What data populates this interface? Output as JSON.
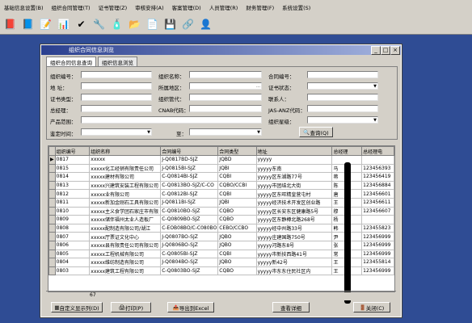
{
  "menu": [
    "基础信息设置(B)",
    "组织合同管理(T)",
    "证书管理(Z)",
    "审核安排(A)",
    "客案管理(D)",
    "人员管理(R)",
    "财务管理(F)",
    "系统设置(S)"
  ],
  "window": {
    "title": "组织合同信息浏览"
  },
  "tabs": [
    "组织合同信息查询",
    "组织信息浏览"
  ],
  "form": {
    "org_no": "组织编号：",
    "org_name": "组织名称：",
    "contract_no": "合同编号：",
    "address": "地  址：",
    "region": "所属地区：",
    "cert_status": "证书状态：",
    "cert_type": "证书类型：",
    "org_manager": "组织管代：",
    "contact": "联系人：",
    "general_manager": "总经理：",
    "cnab_code": "CNAB代码：",
    "jas_code": "JAS-ANZ代码：",
    "product_scope": "产品范围：",
    "org_star": "组织星级：",
    "sign_time": "鉴定时间：",
    "to": "至：",
    "query_btn": "查询(Q)"
  },
  "table": {
    "headers": [
      "组织编号",
      "组织名称",
      "合同编号",
      "合同类型",
      "地址",
      "总经理",
      "总经理电"
    ],
    "rows": [
      [
        "0817",
        "xxxxx",
        "J-Q0817BD-SJZ",
        "JQBD",
        "yyyyy",
        "",
        ""
      ],
      [
        "0815",
        "xxxxx化工经销有限责任公司",
        "J-Q0815BI-SJZ",
        "JQBI",
        "yyyyy东南",
        "马",
        "123456393"
      ],
      [
        "0814",
        "xxxxx建材有限公司",
        "C-Q0814BI-SJZ",
        "CQBI",
        "yyyyy区东湖路77号",
        "蒋",
        "123456419"
      ],
      [
        "0813",
        "xxxxx兴建筑安装工程有限公司",
        "C-Q0813BO-SJZ/C-CO",
        "CQBO/CCBI",
        "yyyyy市团结北大街",
        "陈",
        "123456884"
      ],
      [
        "0812",
        "xxxxx业有限公司",
        "C-Q0812BI-SJZ",
        "CQBI",
        "yyyyy区东旺精皇营屯村",
        "唐",
        "123456601"
      ],
      [
        "0811",
        "xxxxx新加金刚石工具有限公司",
        "J-Q0811BI-SJZ",
        "JQBI",
        "yyyyy经济技术开发区创业路",
        "王",
        "123456611"
      ],
      [
        "0810",
        "xxxxx主义食学团石家庄市有限",
        "C-Q0810BO-SJZ",
        "CQBO",
        "yyyyy区长安东区健康路5号",
        "穆",
        "123456607"
      ],
      [
        "0809",
        "xxxxx储伴福州太业人造板厂",
        "C-Q0809BO-SJZ",
        "CQBO",
        "yyyyy区东静樽北路268号",
        "杨",
        ""
      ],
      [
        "0808",
        "xxxxx配制造有限公司/湖江",
        "C-EOB08BO/C-C080BO",
        "CEBO/CCBO",
        "yyyyy经中州路33号",
        "韩",
        "123455823"
      ],
      [
        "0807",
        "xxxxx厅票证文化中心",
        "J-Q0807BO-SJZ",
        "JQBO",
        "yyyyy庄建国路750号",
        "尹",
        "123456999"
      ],
      [
        "0806",
        "xxxxx县有限责任公司有限公司",
        "J-Q0806BO-SJZ",
        "JQBO",
        "yyyyy河路东8号",
        "张",
        "123456999"
      ],
      [
        "0805",
        "xxxxx工程机械有限公司",
        "C-Q0805BI-SJZ",
        "CQBI",
        "yyyyy市新技西路41号",
        "常",
        "123456999"
      ],
      [
        "0804",
        "xxxxx维纺制造有限公司",
        "J-Q0804BO-SJZ",
        "JQBO",
        "yyyyy新42号",
        "王",
        "123455814"
      ],
      [
        "0803",
        "xxxxx建筑工程有限公司",
        "C-Q0803BO-SJZ",
        "CQBO",
        "yyyyy市东东住民社区内",
        "王",
        "123456999"
      ]
    ],
    "footer_count": "67"
  },
  "buttons": {
    "custom": "自定义显示列(D)",
    "print": "打印(P)",
    "export": "导出到Excel",
    "detail": "查看详细",
    "close": "关闭(C)"
  }
}
